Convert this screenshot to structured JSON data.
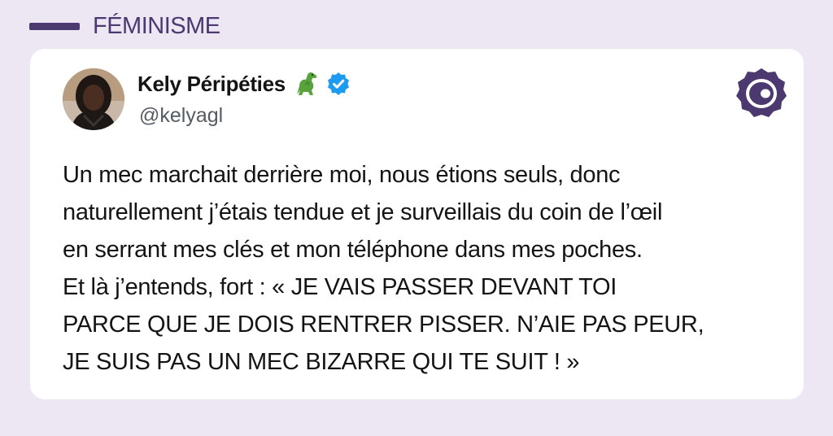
{
  "category": {
    "label": "FÉMINISME"
  },
  "tweet": {
    "author_name": "Kely Péripéties",
    "author_emoji": "dinosaur-emoji",
    "verified": true,
    "author_handle": "@kelyagl",
    "text": "Un mec marchait derrière moi, nous étions seuls, donc\nnaturellement j’étais tendue et je surveillais du coin de l’œil\nen serrant mes clés et mon téléphone dans mes poches.\nEt là j’entends, fort : « JE VAIS PASSER DEVANT TOI\nPARCE QUE JE DOIS RENTRER PISSER. N’AIE PAS PEUR,\nJE SUIS PAS UN MEC BIZARRE QUI TE SUIT ! »"
  },
  "colors": {
    "background": "#ece7f3",
    "accent": "#4b3970",
    "verified_blue": "#1d9bf0",
    "card": "#ffffff"
  },
  "icons": {
    "brand_logo": "brand-logo-icon",
    "verified": "verified-badge-icon"
  }
}
